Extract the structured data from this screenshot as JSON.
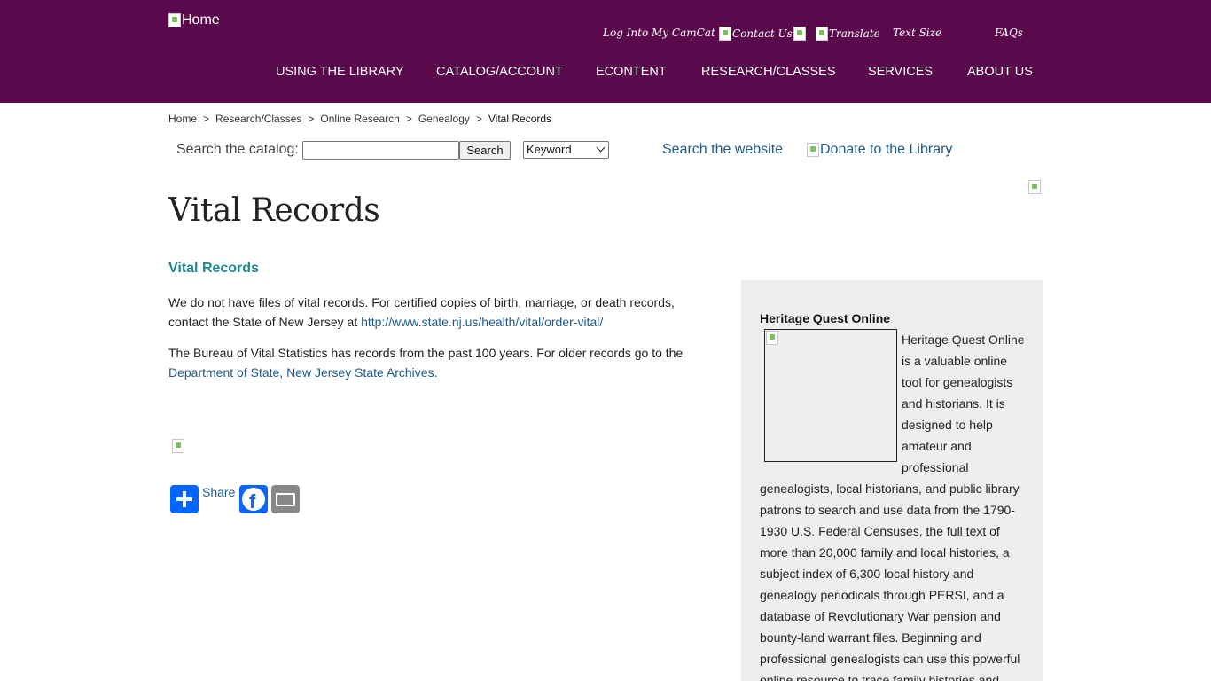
{
  "header": {
    "home_alt": "Home",
    "util_links": {
      "login": "Log Into My CamCat",
      "contact": "Contact Us",
      "translate": "Translate",
      "text_size": "Text Size",
      "faqs": "FAQs"
    },
    "nav": [
      "USING THE LIBRARY",
      "CATALOG/ACCOUNT",
      "ECONTENT",
      "RESEARCH/CLASSES",
      "SERVICES",
      "ABOUT US"
    ],
    "bg_color": "#5a0a4c"
  },
  "breadcrumb": {
    "items": [
      "Home",
      "Research/Classes",
      "Online Research",
      "Genealogy"
    ],
    "current": "Vital Records",
    "separator": ">"
  },
  "search": {
    "label": "Search the catalog:",
    "input_value": "",
    "button": "Search",
    "select_value": "Keyword",
    "website_link": "Search the website",
    "donate_alt": "Donate to the Library"
  },
  "main": {
    "title": "Vital Records",
    "heading": "Vital Records",
    "para1_text": "We do not have files of vital records.  For certified copies of birth, marriage, or death records, contact the State of New Jersey at ",
    "para1_link": "http://www.state.nj.us/health/vital/order-vital/",
    "para2_text": "The Bureau of Vital Statistics has records from the past 100 years. For older records go to the ",
    "para2_link": "Department of State, New Jersey State Archives.",
    "share_label": "Share"
  },
  "sidebar": {
    "title": "Heritage Quest Online",
    "body": "Heritage Quest Online is a valuable online tool for genealogists and historians. It is designed to help amateur and professional genealogists, local historians, and public library patrons to search and use data from the 1790-1930 U.S. Federal Censuses, the full text of more than 20,000 family and local histories, a subject index of 6,300 local history and genealogy periodicals through PERSI, and a database of Revolutionary War pension and bounty-land warrant files. Beginning and professional genealogists can use this powerful online resource to trace family histories and"
  },
  "colors": {
    "accent_teal": "#1b8a8e",
    "link_blue": "#1f5a8a",
    "sidebar_bg": "#eeeeee"
  }
}
